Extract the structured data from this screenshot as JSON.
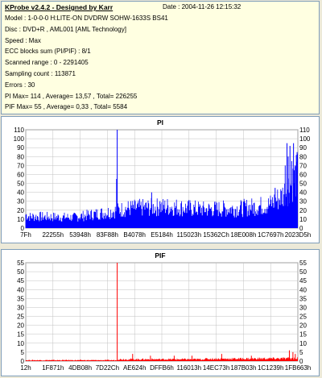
{
  "app": {
    "title": "KProbe v2.4.2 - Designed by Karr",
    "date_line": "Date : 2004-11-26 12:15:32"
  },
  "info": {
    "model": "Model : 1-0-0-0 H:LITE-ON DVDRW SOHW-1633S BS41",
    "disc": "Disc : DVD+R , AML001 [AML Technology]",
    "speed": "Speed : Max",
    "ecc": "ECC blocks sum (PI/PIF) : 8/1",
    "scanned": "Scanned range : 0 - 2291405",
    "sampling": "Sampling count : 113871",
    "errors": "Errors : 30",
    "pi_stats": "PI Max= 114 , Average= 13,57 , Total= 226255",
    "pif_stats": "PIF Max= 55 , Average= 0,33 , Total= 5584"
  },
  "colors": {
    "panel_bg": "#ffffe1",
    "window_bg": "#ece9d8",
    "pi_series": "#0000ff",
    "pif_series": "#ff0000",
    "title_color": "#000080",
    "grid": "#c0c0c0"
  },
  "chart_data": [
    {
      "type": "bar",
      "title": "PI",
      "ylim": [
        0,
        110
      ],
      "yticks": [
        0,
        10,
        20,
        30,
        40,
        50,
        60,
        70,
        80,
        90,
        100,
        110
      ],
      "xlim": [
        0,
        2291405
      ],
      "xtick_labels": [
        "7Fh",
        "22255h",
        "53948h",
        "83F88h",
        "B4078h",
        "E5184h",
        "115023h",
        "15362Ch",
        "18E008h",
        "1C7697h",
        "2023D5h"
      ],
      "grid": true,
      "series": [
        {
          "color": "#0000ff",
          "segments": [
            {
              "x": [
                0,
                50000
              ],
              "y": [
                15,
                12
              ]
            },
            {
              "x": [
                50000,
                400000
              ],
              "y": [
                13,
                12
              ]
            },
            {
              "x": [
                400000,
                600000
              ],
              "y": [
                12,
                16
              ]
            },
            {
              "x": [
                600000,
                700000
              ],
              "y": [
                16,
                18
              ]
            },
            {
              "x": [
                700000,
                780000
              ],
              "y": [
                18,
                20
              ]
            },
            {
              "x": [
                780000,
                850000
              ],
              "y": [
                20,
                22
              ]
            },
            {
              "x": [
                850000,
                1200000
              ],
              "y": [
                22,
                24
              ]
            },
            {
              "x": [
                1200000,
                1500000
              ],
              "y": [
                24,
                21
              ]
            },
            {
              "x": [
                1500000,
                1800000
              ],
              "y": [
                21,
                22
              ]
            },
            {
              "x": [
                1800000,
                2050000
              ],
              "y": [
                22,
                26
              ]
            },
            {
              "x": [
                2050000,
                2150000
              ],
              "y": [
                26,
                35
              ]
            },
            {
              "x": [
                2150000,
                2291405
              ],
              "y": [
                35,
                60
              ]
            }
          ],
          "spikes": [
            {
              "x": 770000,
              "y": 114
            },
            {
              "x": 765000,
              "y": 55
            },
            {
              "x": 1060000,
              "y": 40
            },
            {
              "x": 1130000,
              "y": 30
            },
            {
              "x": 2100000,
              "y": 45
            },
            {
              "x": 2185000,
              "y": 70
            },
            {
              "x": 2200000,
              "y": 95
            },
            {
              "x": 2210000,
              "y": 80
            },
            {
              "x": 2225000,
              "y": 92
            },
            {
              "x": 2240000,
              "y": 75
            },
            {
              "x": 2255000,
              "y": 95
            },
            {
              "x": 2270000,
              "y": 70
            },
            {
              "x": 2285000,
              "y": 85
            }
          ]
        }
      ]
    },
    {
      "type": "bar",
      "title": "PIF",
      "ylim": [
        0,
        55
      ],
      "yticks": [
        0,
        5,
        10,
        15,
        20,
        25,
        30,
        35,
        40,
        45,
        50,
        55
      ],
      "xlim": [
        0,
        2291405
      ],
      "xtick_labels": [
        "12h",
        "1F871h",
        "4DB08h",
        "7D22Ch",
        "AE624h",
        "DFFB6h",
        "116013h",
        "14EC73h",
        "187B03h",
        "1C1239h",
        "1FB663h"
      ],
      "grid": true,
      "series": [
        {
          "color": "#ff0000",
          "segments": [
            {
              "x": [
                0,
                770000
              ],
              "y": [
                0.5,
                0.5
              ]
            },
            {
              "x": [
                770000,
                1500000
              ],
              "y": [
                1,
                1
              ]
            },
            {
              "x": [
                1500000,
                2291405
              ],
              "y": [
                1.2,
                1.5
              ]
            }
          ],
          "spikes": [
            {
              "x": 770000,
              "y": 55
            },
            {
              "x": 900000,
              "y": 4
            },
            {
              "x": 1050000,
              "y": 3
            },
            {
              "x": 1250000,
              "y": 3
            },
            {
              "x": 1400000,
              "y": 3
            },
            {
              "x": 1650000,
              "y": 4
            },
            {
              "x": 1900000,
              "y": 3
            },
            {
              "x": 2220000,
              "y": 6
            },
            {
              "x": 2250000,
              "y": 5
            },
            {
              "x": 2270000,
              "y": 4
            }
          ]
        }
      ]
    }
  ]
}
